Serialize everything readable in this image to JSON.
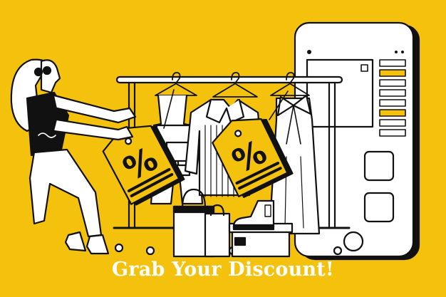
{
  "banner": {
    "headline": "Grab Your Discount!",
    "background_color": "#F4C20D",
    "text_color": "#FFFFFF",
    "ink_color": "#111111"
  },
  "tags": [
    {
      "symbol": "%"
    },
    {
      "symbol": "%"
    }
  ],
  "icons": [
    "woman-pulling-rack",
    "clothing-rack",
    "hanger",
    "shopping-bag",
    "shoebox",
    "ankle-boot",
    "smartphone"
  ]
}
